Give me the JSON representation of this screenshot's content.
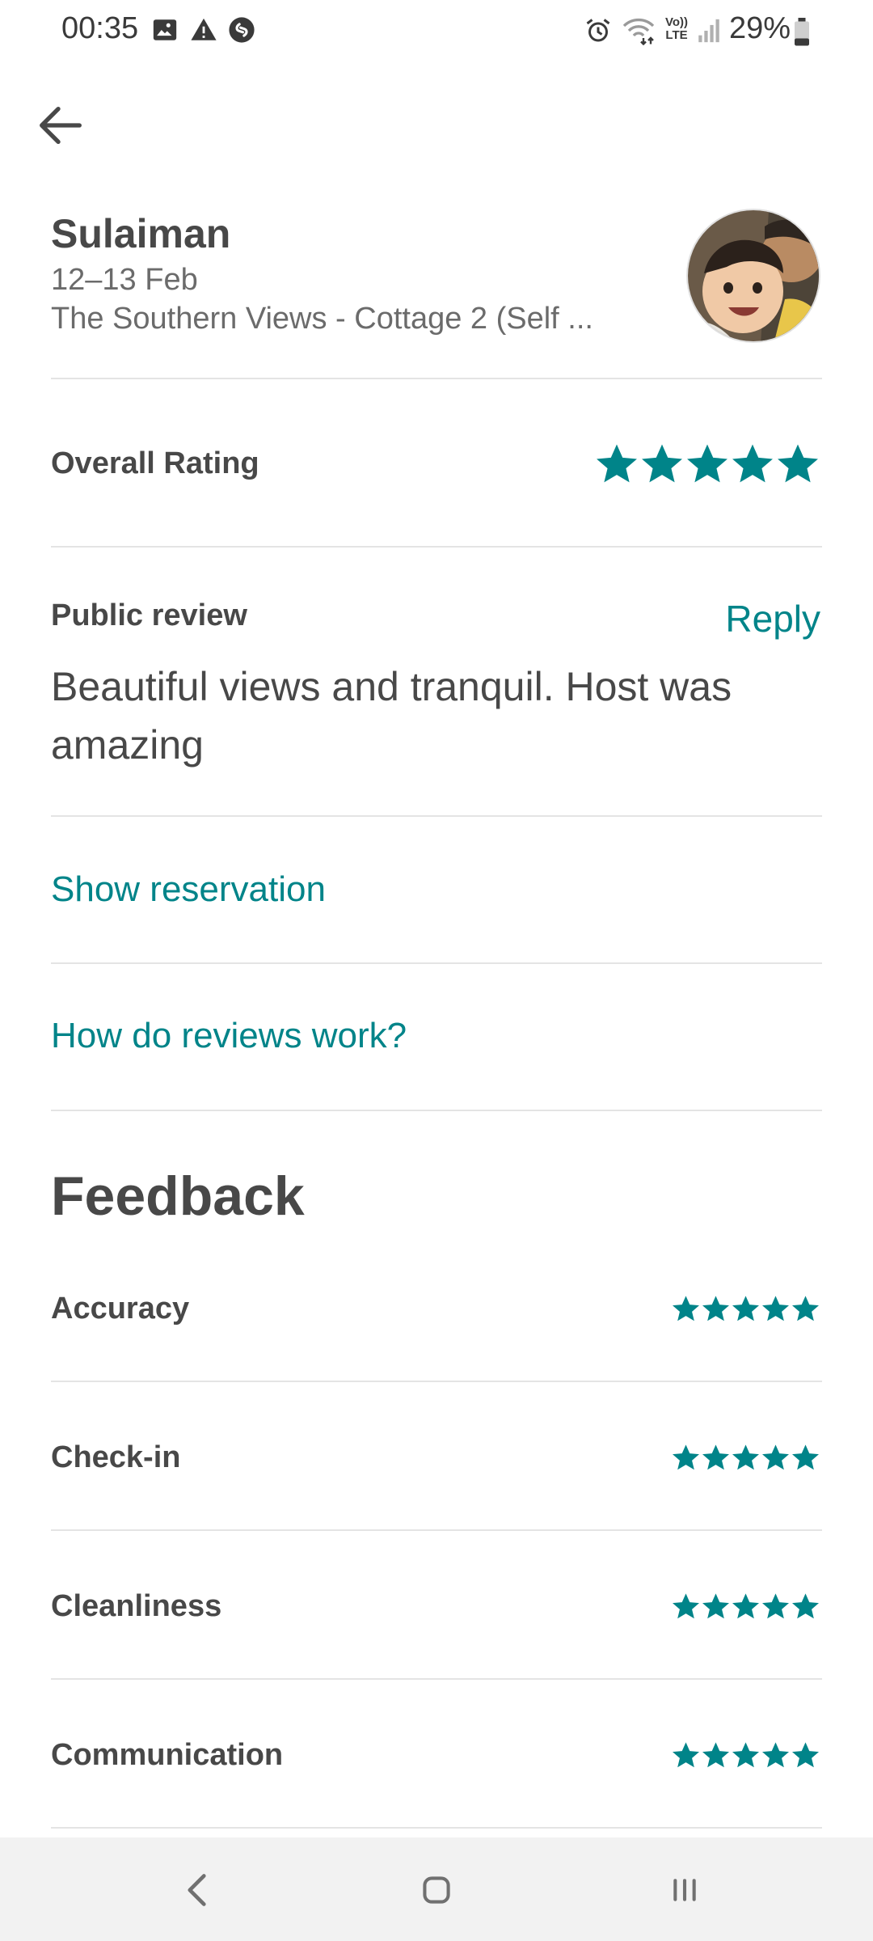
{
  "status_bar": {
    "time": "00:35",
    "battery": "29%",
    "icons": [
      "image-icon",
      "warning-icon",
      "shazam-icon",
      "alarm-icon",
      "wifi-icon",
      "volte-icon",
      "signal-icon",
      "battery-icon"
    ]
  },
  "header": {
    "back_icon": "arrow-left-icon"
  },
  "guest": {
    "name": "Sulaiman",
    "dates": "12–13 Feb",
    "listing": "The Southern Views - Cottage 2 (Self ..."
  },
  "overall": {
    "label": "Overall Rating",
    "stars": 5
  },
  "review": {
    "label": "Public review",
    "reply": "Reply",
    "text": "Beautiful views and tranquil. Host was amazing"
  },
  "links": {
    "show_reservation": "Show reservation",
    "how_reviews_work": "How do reviews work?"
  },
  "feedback": {
    "title": "Feedback",
    "items": [
      {
        "label": "Accuracy",
        "stars": 5
      },
      {
        "label": "Check-in",
        "stars": 5
      },
      {
        "label": "Cleanliness",
        "stars": 5
      },
      {
        "label": "Communication",
        "stars": 5
      }
    ]
  },
  "colors": {
    "accent": "#008489",
    "text": "#484848",
    "divider": "#e4e4e4"
  },
  "nav": {
    "icons": [
      "back-nav-icon",
      "home-nav-icon",
      "recents-nav-icon"
    ]
  }
}
